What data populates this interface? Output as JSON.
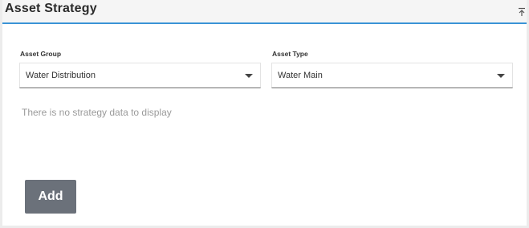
{
  "header": {
    "title": "Asset Strategy",
    "collapse_icon": "collapse-up-icon"
  },
  "filters": {
    "asset_group": {
      "label": "Asset Group",
      "value": "Water Distribution"
    },
    "asset_type": {
      "label": "Asset Type",
      "value": "Water Main"
    }
  },
  "main": {
    "empty_message": "There is no strategy data to display"
  },
  "actions": {
    "add_label": "Add"
  },
  "colors": {
    "accent": "#3a93d6",
    "button": "#6b717a"
  }
}
